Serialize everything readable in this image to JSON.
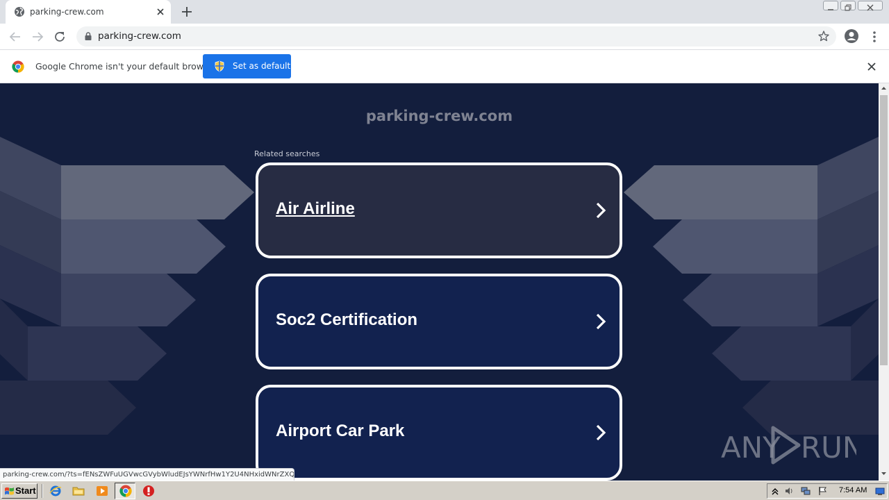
{
  "browser": {
    "tab": {
      "title": "parking-crew.com",
      "close_icon": "close-icon"
    },
    "new_tab_icon": "plus-icon",
    "address_bar": {
      "url": "parking-crew.com"
    },
    "infobar": {
      "message": "Google Chrome isn't your default browser",
      "button_label": "Set as default"
    },
    "status_url": "parking-crew.com/?ts=fENsZWFuUGVwcGVybWludEJsYWNrfHw1Y2U4NHxidWNrZXQ..."
  },
  "page": {
    "site_title": "parking-crew.com",
    "related_label": "Related searches",
    "results": [
      {
        "label": "Air Airline",
        "state": "hover"
      },
      {
        "label": "Soc2 Certification",
        "state": "normal"
      },
      {
        "label": "Airport Car Park",
        "state": "normal"
      }
    ],
    "watermark": "ANY RUN"
  },
  "taskbar": {
    "start_label": "Start",
    "clock": "7:54 AM"
  },
  "colors": {
    "page_bg": "#131e3d",
    "card_bg": "#12224f",
    "card_hover_bg": "#272c43",
    "accent_button": "#1a73e8"
  }
}
